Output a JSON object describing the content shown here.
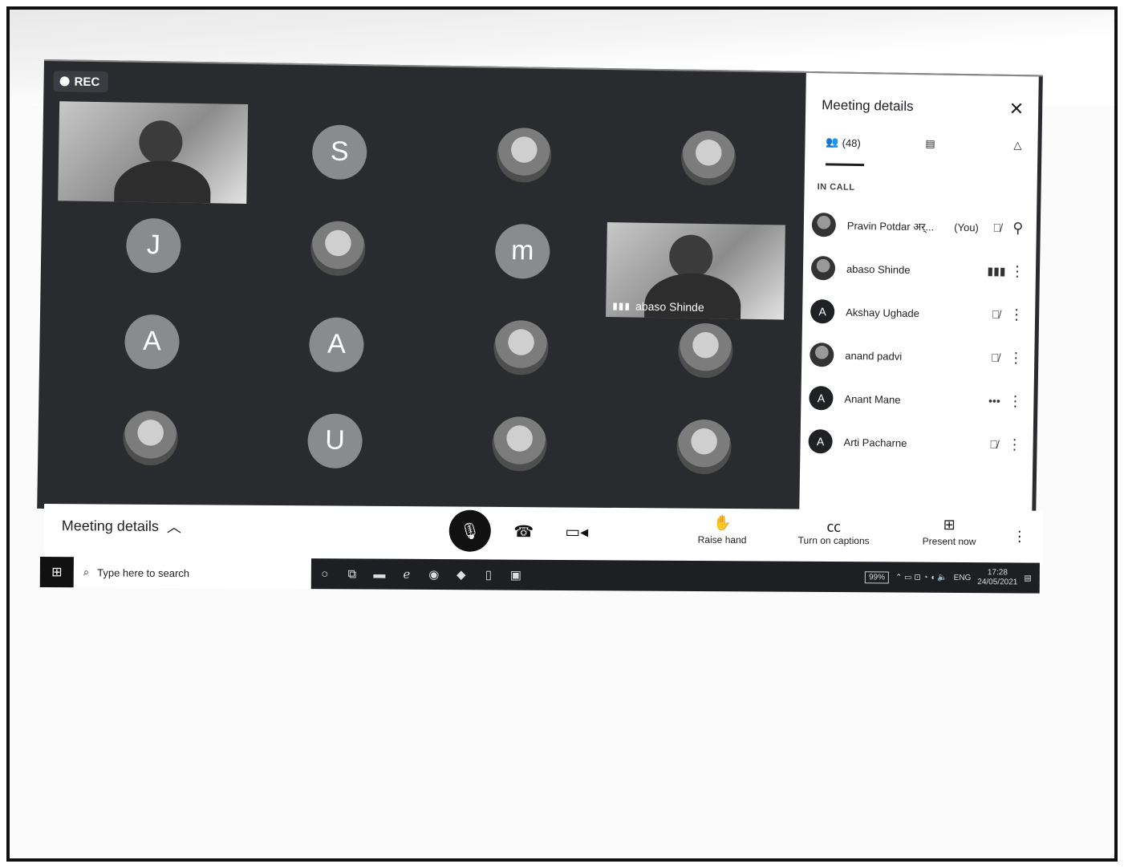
{
  "stage": {
    "rec_label": "REC",
    "tiles": [
      {
        "kind": "letter",
        "letter": "S"
      },
      {
        "kind": "photo"
      },
      {
        "kind": "photo"
      },
      {
        "kind": "letter",
        "letter": "J"
      },
      {
        "kind": "photo"
      },
      {
        "kind": "letter",
        "letter": "m"
      },
      {
        "kind": "letter",
        "letter": "A"
      },
      {
        "kind": "letter",
        "letter": "A"
      },
      {
        "kind": "photo"
      },
      {
        "kind": "photo"
      },
      {
        "kind": "photo"
      },
      {
        "kind": "letter",
        "letter": "U"
      },
      {
        "kind": "photo"
      },
      {
        "kind": "photo"
      }
    ],
    "speaker_name": "abaso Shinde"
  },
  "panel": {
    "title": "Meeting details",
    "people_count": "(48)",
    "section_label": "IN CALL",
    "participants": [
      {
        "name": "Pravin Potdar अर्...",
        "avatar": "photo",
        "letter": "",
        "you": "(You)",
        "status": "mic-off",
        "action": "pin"
      },
      {
        "name": "abaso Shinde",
        "avatar": "photo",
        "letter": "",
        "you": "",
        "status": "speaking",
        "action": "more"
      },
      {
        "name": "Akshay Ughade",
        "avatar": "letter",
        "letter": "A",
        "you": "",
        "status": "mic-off",
        "action": "more"
      },
      {
        "name": "anand padvi",
        "avatar": "photo",
        "letter": "",
        "you": "",
        "status": "mic-off",
        "action": "more"
      },
      {
        "name": "Anant Mane",
        "avatar": "letter",
        "letter": "A",
        "you": "",
        "status": "dots",
        "action": "more"
      },
      {
        "name": "Arti Pacharne",
        "avatar": "letter",
        "letter": "A",
        "you": "",
        "status": "mic-off",
        "action": "more"
      }
    ]
  },
  "controls": {
    "meeting_details": "Meeting details",
    "raise_hand": "Raise hand",
    "captions": "Turn on captions",
    "present": "Present now"
  },
  "taskbar": {
    "search_placeholder": "Type here to search",
    "battery": "99%",
    "language": "ENG",
    "time": "17:28",
    "date": "24/05/2021"
  }
}
